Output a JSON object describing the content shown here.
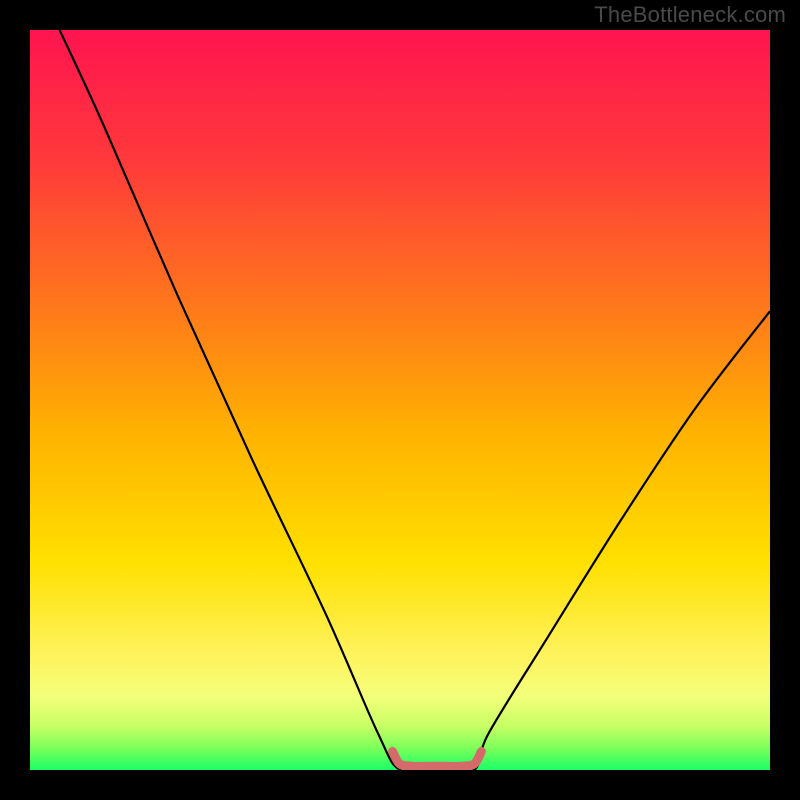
{
  "watermark": {
    "text": "TheBottleneck.com"
  },
  "chart_data": {
    "type": "line",
    "title": "",
    "xlabel": "",
    "ylabel": "",
    "x_range": [
      0,
      100
    ],
    "y_range": [
      0,
      100
    ],
    "series": [
      {
        "name": "bottleneck-curve",
        "x": [
          4,
          10,
          20,
          30,
          40,
          47,
          50,
          55,
          60,
          62,
          70,
          80,
          90,
          100
        ],
        "y": [
          100,
          87,
          64,
          42,
          21,
          5,
          0,
          0,
          0,
          5,
          18,
          34,
          49,
          62
        ]
      },
      {
        "name": "optimal-band",
        "x": [
          49,
          50,
          52,
          54,
          56,
          58,
          60,
          61
        ],
        "y": [
          2.5,
          0.8,
          0.5,
          0.5,
          0.5,
          0.5,
          0.8,
          2.5
        ]
      }
    ],
    "background_gradient": {
      "stops": [
        {
          "pos": 0.0,
          "color": "#ff1450"
        },
        {
          "pos": 0.18,
          "color": "#ff3a3a"
        },
        {
          "pos": 0.38,
          "color": "#ff7a1a"
        },
        {
          "pos": 0.55,
          "color": "#ffb400"
        },
        {
          "pos": 0.72,
          "color": "#ffe000"
        },
        {
          "pos": 0.84,
          "color": "#fff25a"
        },
        {
          "pos": 0.9,
          "color": "#f4ff7a"
        },
        {
          "pos": 0.94,
          "color": "#c8ff64"
        },
        {
          "pos": 0.97,
          "color": "#7dff5a"
        },
        {
          "pos": 1.0,
          "color": "#1aff66"
        }
      ]
    },
    "curve_color": "#000000",
    "band_color": "#d46a6a"
  }
}
